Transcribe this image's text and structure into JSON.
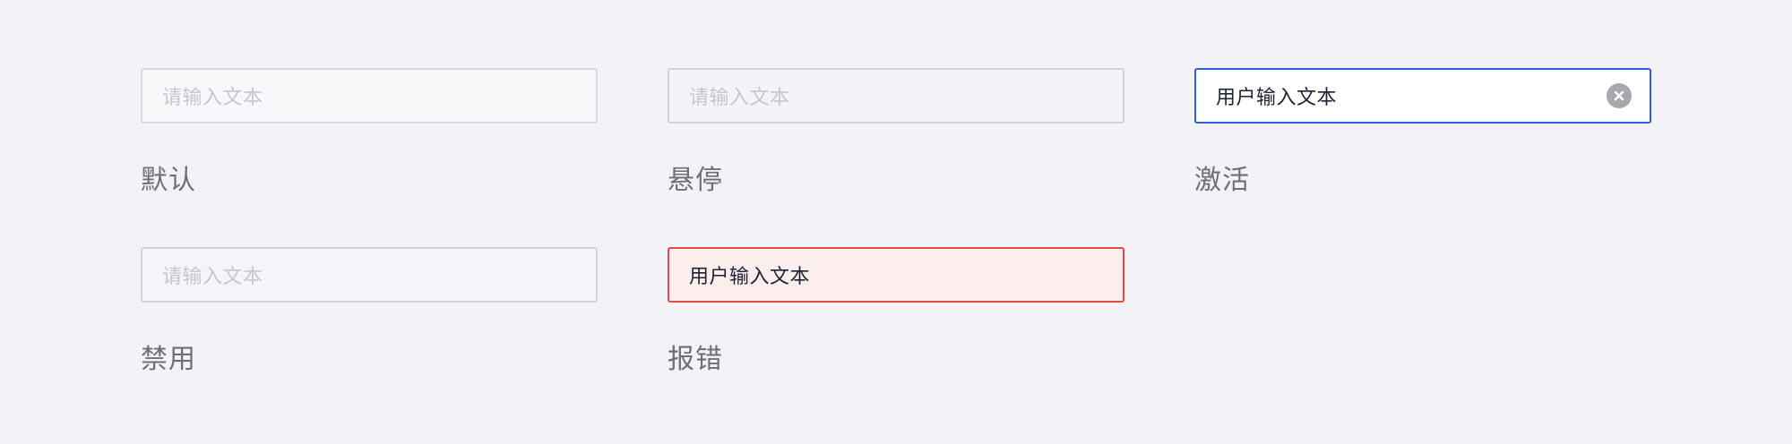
{
  "states": {
    "default": {
      "placeholder": "请输入文本",
      "label": "默认"
    },
    "hover": {
      "placeholder": "请输入文本",
      "label": "悬停"
    },
    "active": {
      "value": "用户输入文本",
      "label": "激活",
      "clear_icon": "clear-circle-icon"
    },
    "disabled": {
      "placeholder": "请输入文本",
      "label": "禁用"
    },
    "error": {
      "value": "用户输入文本",
      "label": "报错"
    }
  },
  "colors": {
    "background": "#f3f2f7",
    "active_border": "#2f5fe0",
    "error_border": "#e04a47",
    "error_fill": "#fdeeee",
    "placeholder": "#c4c6d1",
    "value_text": "#1e2236",
    "label_text": "#6d6e78"
  }
}
